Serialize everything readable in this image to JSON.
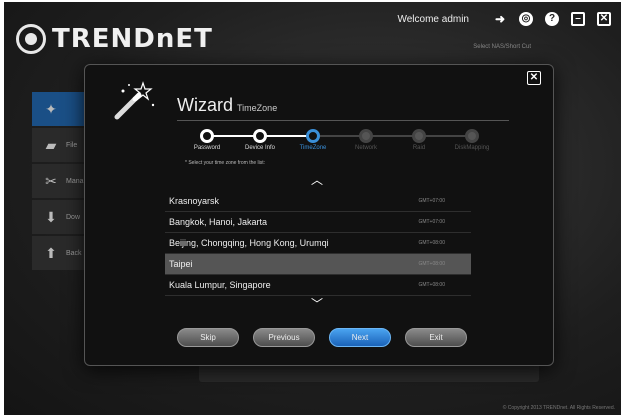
{
  "brand": {
    "name": "TRENDnET"
  },
  "header": {
    "welcome": "Welcome admin",
    "shortcut": "Select NAS/Short Cut",
    "icons": [
      "logout-icon",
      "settings-icon",
      "help-icon",
      "minimize-icon",
      "close-icon"
    ]
  },
  "sidebar": {
    "items": [
      {
        "label": "",
        "icon": "wizard-icon",
        "active": true
      },
      {
        "label": "File",
        "icon": "folder-icon"
      },
      {
        "label": "Mana",
        "icon": "tools-icon"
      },
      {
        "label": "Dow",
        "icon": "download-icon"
      },
      {
        "label": "Back",
        "icon": "backup-icon"
      }
    ]
  },
  "wizard": {
    "title": "Wizard",
    "subtitle": "TimeZone",
    "steps": [
      {
        "label": "Password",
        "state": "done"
      },
      {
        "label": "Device Info",
        "state": "done"
      },
      {
        "label": "TimeZone",
        "state": "current"
      },
      {
        "label": "Network",
        "state": "pending"
      },
      {
        "label": "Raid",
        "state": "pending"
      },
      {
        "label": "DiskMapping",
        "state": "pending"
      }
    ],
    "hint": "* Select your time zone from the list:",
    "timezones": [
      {
        "name": "Krasnoyarsk",
        "gmt": "GMT+07:00",
        "selected": false
      },
      {
        "name": "Bangkok, Hanoi, Jakarta",
        "gmt": "GMT+07:00",
        "selected": false
      },
      {
        "name": "Beijing, Chongqing, Hong Kong, Urumqi",
        "gmt": "GMT+08:00",
        "selected": false
      },
      {
        "name": "Taipei",
        "gmt": "GMT+08:00",
        "selected": true
      },
      {
        "name": "Kuala Lumpur, Singapore",
        "gmt": "GMT+08:00",
        "selected": false
      }
    ],
    "buttons": {
      "skip": "Skip",
      "previous": "Previous",
      "next": "Next",
      "exit": "Exit"
    }
  },
  "footer": "© Copyright 2013 TRENDnet. All Rights Reserved.",
  "colors": {
    "accent": "#3a8fd8",
    "primary_button": "#1a62b8",
    "selected_row": "#555555"
  }
}
